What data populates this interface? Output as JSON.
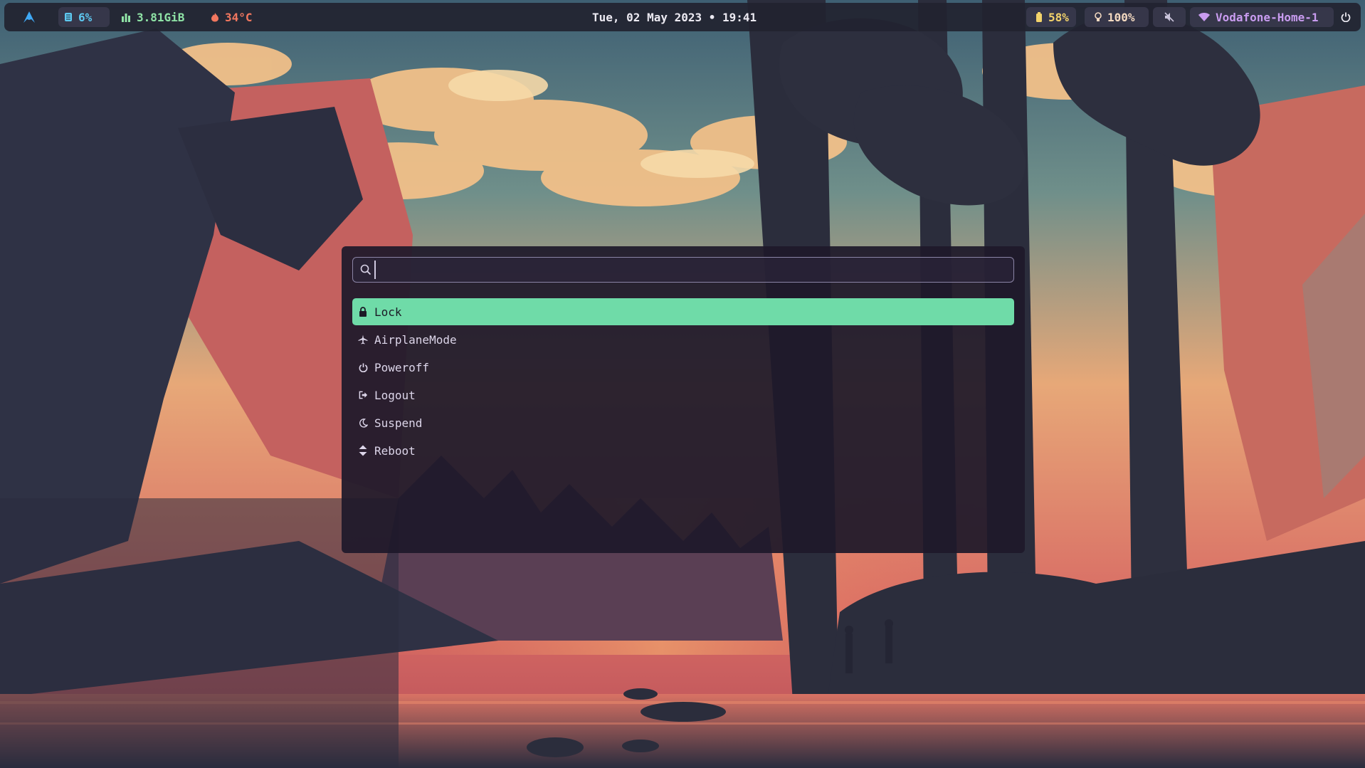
{
  "topbar": {
    "launcher_icon": "arch-logo-icon",
    "cpu": {
      "icon": "cpu-icon",
      "value": "6%",
      "color": "#5ec8f0"
    },
    "memory": {
      "icon": "bar-chart-icon",
      "value": "3.81GiB",
      "color": "#8fe3a6"
    },
    "temperature": {
      "icon": "flame-icon",
      "value": "34°C",
      "color": "#f2775f"
    },
    "clock": "Tue, 02 May 2023 • 19:41",
    "battery": {
      "icon": "battery-icon",
      "value": "58%",
      "color": "#f3d36b"
    },
    "brightness": {
      "icon": "lightbulb-icon",
      "value": "100%",
      "color": "#f3d9c0"
    },
    "volume": {
      "icon": "speaker-muted-icon"
    },
    "network": {
      "icon": "wifi-icon",
      "value": "Vodafone-Home-1",
      "color": "#c99cf0"
    },
    "power": {
      "icon": "power-icon"
    }
  },
  "launcher": {
    "search": {
      "icon": "search-icon",
      "value": ""
    },
    "items": [
      {
        "label": "Lock",
        "icon": "lock-icon",
        "selected": true
      },
      {
        "label": "AirplaneMode",
        "icon": "airplane-icon",
        "selected": false
      },
      {
        "label": "Poweroff",
        "icon": "power-icon",
        "selected": false
      },
      {
        "label": "Logout",
        "icon": "logout-icon",
        "selected": false
      },
      {
        "label": "Suspend",
        "icon": "moon-icon",
        "selected": false
      },
      {
        "label": "Reboot",
        "icon": "reboot-icon",
        "selected": false
      }
    ],
    "accent": "#6fdba8"
  }
}
